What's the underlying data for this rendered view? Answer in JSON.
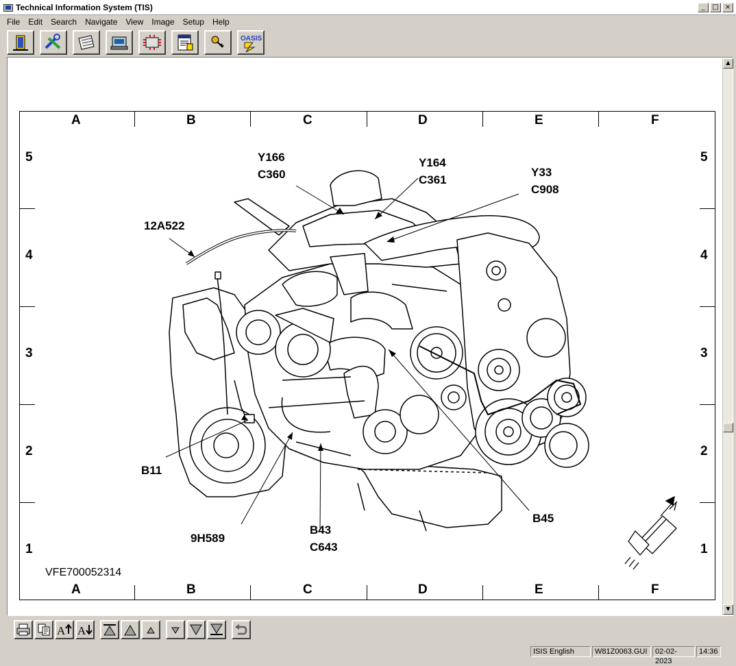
{
  "window": {
    "title": "Technical Information System (TIS)",
    "controls": [
      "_",
      "□",
      "×"
    ]
  },
  "menu": [
    "File",
    "Edit",
    "Search",
    "Navigate",
    "View",
    "Image",
    "Setup",
    "Help"
  ],
  "toolbar": {
    "buttons": [
      {
        "name": "exit-door-icon"
      },
      {
        "name": "tools-icon"
      },
      {
        "name": "document-icon"
      },
      {
        "name": "vehicle-icon"
      },
      {
        "name": "diagnostic-icon"
      },
      {
        "name": "report-icon"
      },
      {
        "name": "key-icon"
      },
      {
        "name": "oasis-icon",
        "label": "OASIS"
      }
    ]
  },
  "diagram": {
    "columns": [
      "A",
      "B",
      "C",
      "D",
      "E",
      "F"
    ],
    "rows": [
      "5",
      "4",
      "3",
      "2",
      "1"
    ],
    "callouts": {
      "y166": [
        "Y166",
        "C360"
      ],
      "y164": [
        "Y164",
        "C361"
      ],
      "y33": [
        "Y33",
        "C908"
      ],
      "a12a522": [
        "12A522"
      ],
      "b11": [
        "B11"
      ],
      "h9h589": [
        "9H589"
      ],
      "b43": [
        "B43",
        "C643"
      ],
      "b45": [
        "B45"
      ]
    },
    "doc_id": "VFE700052314"
  },
  "bottom_toolbar": [
    "print-icon",
    "copy-icon",
    "font-increase-icon",
    "font-decrease-icon",
    "first-page-icon",
    "page-up-icon",
    "line-up-icon",
    "line-down-icon",
    "page-down-icon",
    "last-page-icon",
    "back-icon"
  ],
  "status": {
    "language": "ISIS English",
    "file": "W81Z0063.GUI",
    "date": "02-02-2023",
    "time": "14:36"
  }
}
